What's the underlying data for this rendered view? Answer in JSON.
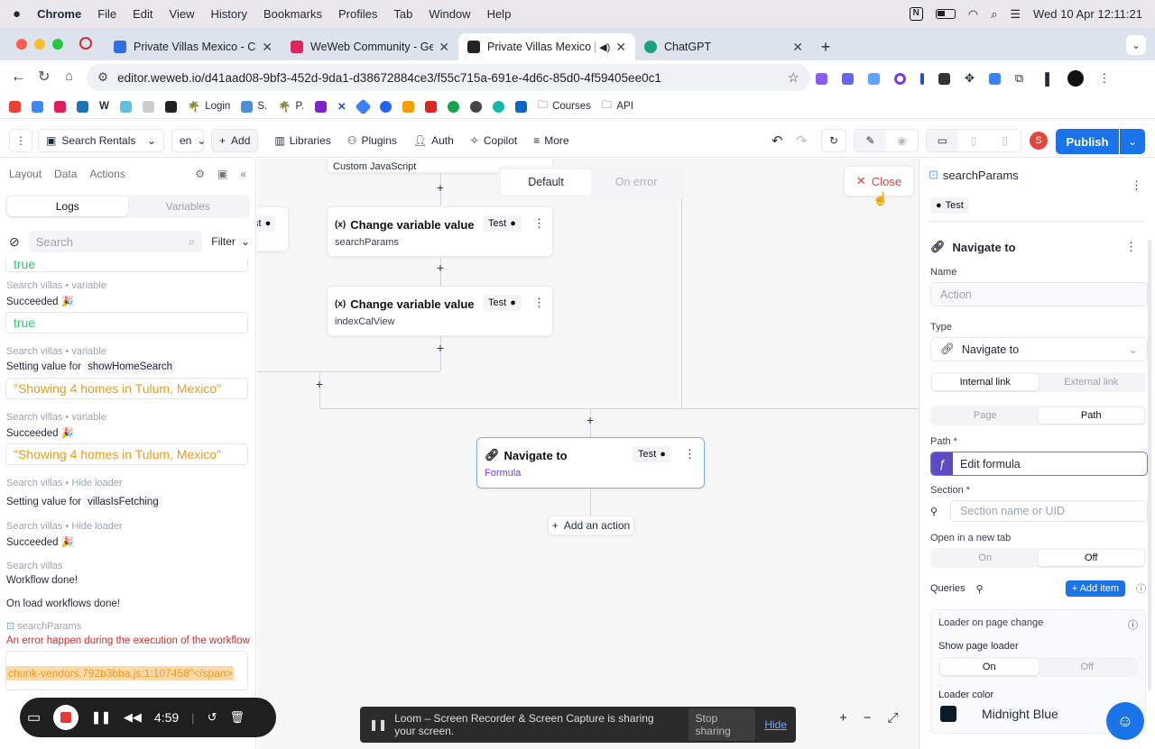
{
  "mac": {
    "app": "Chrome",
    "menus": [
      "File",
      "Edit",
      "View",
      "History",
      "Bookmarks",
      "Profiles",
      "Tab",
      "Window",
      "Help"
    ],
    "datetime": "Wed 10 Apr  12:11:21"
  },
  "tabs": [
    {
      "title": "Private Villas Mexico - Calendar",
      "color": "#2f6fe0"
    },
    {
      "title": "WeWeb Community - Get help",
      "color": "#e0245e"
    },
    {
      "title": "Private Villas Mexico | We",
      "color": "#222222",
      "active": true
    },
    {
      "title": "ChatGPT",
      "color": "#19a37d"
    }
  ],
  "url": "editor.weweb.io/d41aad08-9bf3-452d-9da1-d38672884ce3/f55c715a-691e-4d6c-85d0-4f59405ee0c1",
  "bookmarks": [
    "Login",
    "S.",
    "P.",
    "Courses",
    "API"
  ],
  "toolbar": {
    "page": "Search Rentals",
    "lang": "en",
    "add": "Add",
    "libraries": "Libraries",
    "plugins": "Plugins",
    "auth": "Auth",
    "copilot": "Copilot",
    "more": "More",
    "avatar": "S",
    "publish": "Publish"
  },
  "left": {
    "tabs": [
      "Layout",
      "Data",
      "Actions"
    ],
    "seg": [
      "Logs",
      "Variables"
    ],
    "search_placeholder": "Search",
    "filter": "Filter",
    "top_value": "true",
    "logs": [
      {
        "src": "Search villas • variable",
        "text": "Succeeded 🎉",
        "value": "true",
        "vclass": "green"
      },
      {
        "src": "Search villas • variable",
        "text": "Setting value for",
        "tag": "showHomeSearch",
        "value": "\"Showing 4 homes in Tulum, Mexico\"",
        "vclass": "orange"
      },
      {
        "src": "Search villas • variable",
        "text": "Succeeded 🎉",
        "value": "\"Showing 4 homes in Tulum, Mexico\"",
        "vclass": "orange"
      },
      {
        "src": "Search villas • Hide loader",
        "text": "Setting value for",
        "tag": "villasIsFetching"
      },
      {
        "src": "Search villas • Hide loader",
        "text": "Succeeded 🎉"
      },
      {
        "src": "Search villas",
        "text": "Workflow done!"
      }
    ],
    "onload": "On load workflows done!",
    "err_src": "searchParams",
    "err_text": "An error happen during the execution of the workflow",
    "err_code": "chunk-vendors.792b3bba.js:1:107458\"</span>"
  },
  "canvas": {
    "cjs": "Custom JavaScript",
    "seg": [
      "Default",
      "On error"
    ],
    "close": "Close",
    "card1": {
      "title": "Change variable value",
      "sub": "searchParams"
    },
    "card2": {
      "title": "Change variable value",
      "sub": "indexCalView"
    },
    "nav": {
      "title": "Navigate to",
      "sub": "Formula"
    },
    "test": "Test",
    "test_partial": "st",
    "add_action": "Add an action"
  },
  "right": {
    "sp": "searchParams",
    "sp_test": "Test",
    "nav_title": "Navigate to",
    "name_label": "Name",
    "name_ph": "Action",
    "type_label": "Type",
    "type_val": "Navigate to",
    "link_seg": [
      "Internal link",
      "External link"
    ],
    "pp_seg": [
      "Page",
      "Path"
    ],
    "path_label": "Path *",
    "path_val": "Edit formula",
    "section_label": "Section *",
    "section_ph": "Section name or UID",
    "newtab_label": "Open in a new tab",
    "onoff": [
      "On",
      "Off"
    ],
    "queries": "Queries",
    "add_item": "+ Add item",
    "loader_change": "Loader on page change",
    "show_loader": "Show page loader",
    "loader_color_label": "Loader color",
    "loader_color": "Midnight Blue",
    "loader_hex": "#0b1a2a"
  },
  "loom": {
    "time": "4:59",
    "msg": "Loom – Screen Recorder & Screen Capture is sharing your screen.",
    "stop": "Stop sharing",
    "hide": "Hide"
  }
}
